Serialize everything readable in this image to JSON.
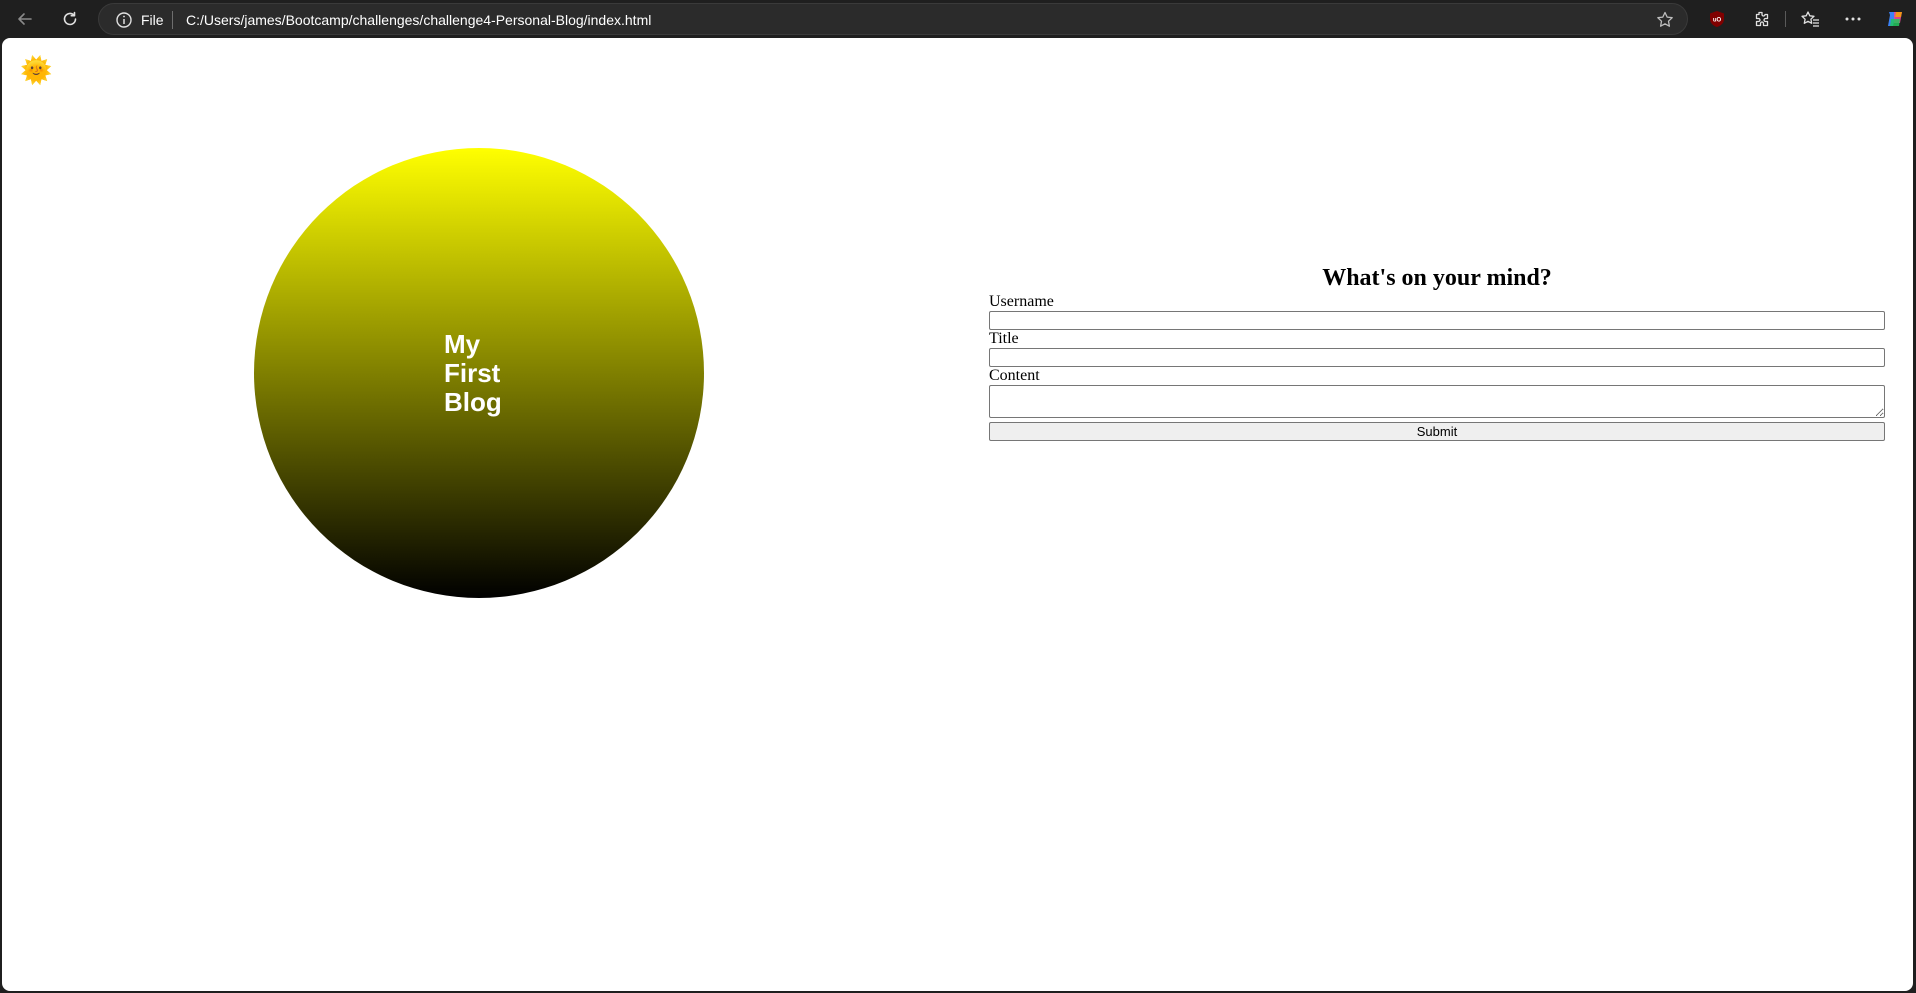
{
  "browser": {
    "address_scheme": "File",
    "url": "C:/Users/james/Bootcamp/challenges/challenge4-Personal-Blog/index.html",
    "icons": [
      "back-arrow-icon",
      "reload-icon",
      "info-icon",
      "star-icon",
      "ublock-origin-icon",
      "extensions-icon",
      "favorites-icon",
      "more-icon",
      "copilot-icon"
    ]
  },
  "page": {
    "theme_toggle": "🌞",
    "blog_title_lines": [
      "My",
      "First",
      "Blog"
    ],
    "circle_gradient": [
      "#ffff00",
      "#000000"
    ],
    "form": {
      "heading": "What's on your mind?",
      "username_label": "Username",
      "username_value": "",
      "title_label": "Title",
      "title_value": "",
      "content_label": "Content",
      "content_value": "",
      "submit_label": "Submit"
    }
  }
}
